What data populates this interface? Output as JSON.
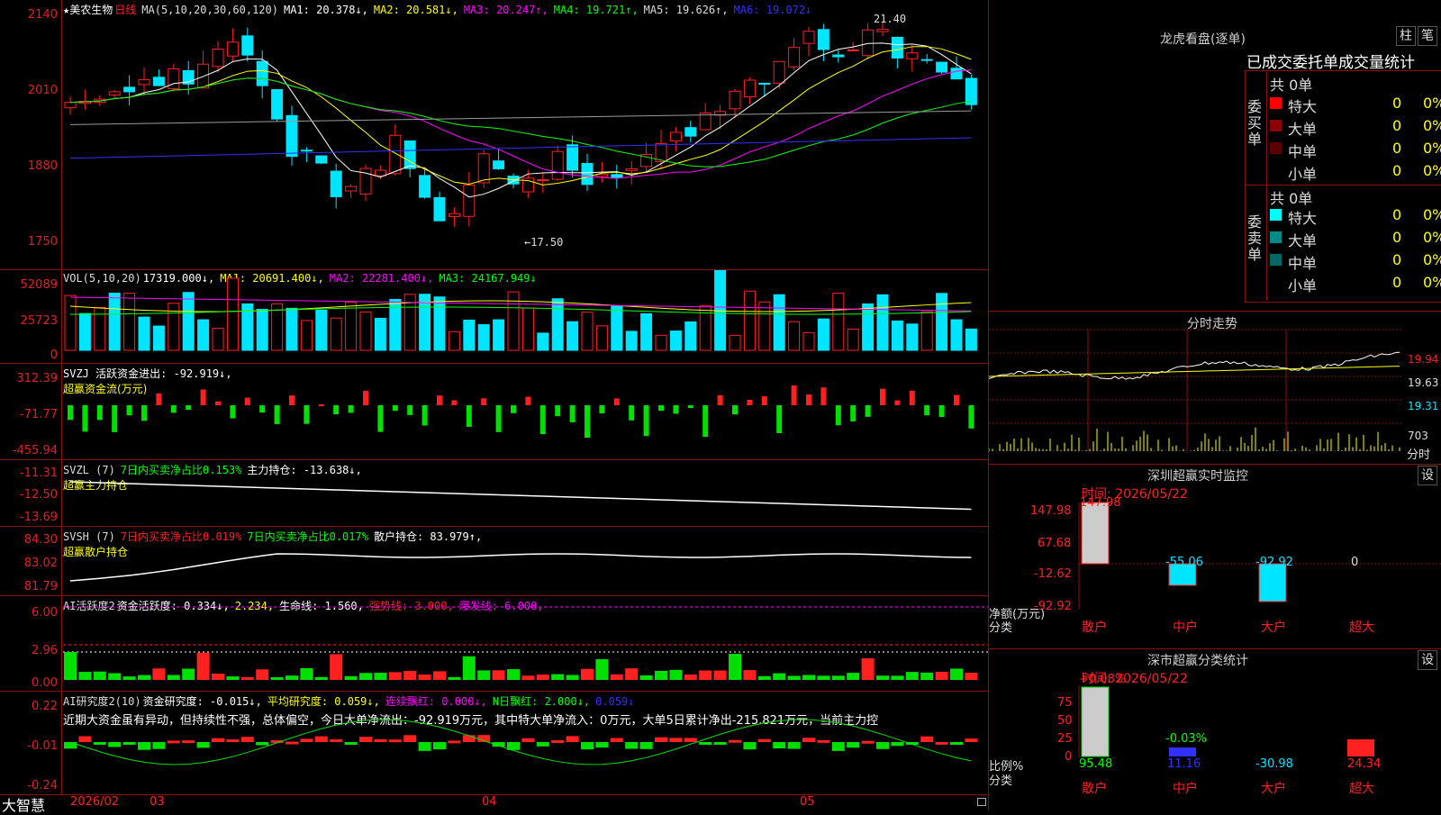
{
  "kline": {
    "star": "★",
    "stock_name": "美农生物",
    "period": "日线",
    "ma_spec": "MA(5,10,20,30,60,120)",
    "ma1": "MA1: 20.378↓,",
    "ma2": "MA2: 20.581↓,",
    "ma3": "MA3: 20.247↑,",
    "ma4": "MA4: 19.721↑,",
    "ma5": "MA5: 19.626↑,",
    "ma6": "MA6: 19.072↓",
    "y_labels": [
      "2140",
      "2010",
      "1880",
      "1750"
    ],
    "high_mark": "21.40",
    "low_mark": "←17.50"
  },
  "vol": {
    "spec": "VOL(5,10,20)",
    "v": "17319.000↓,",
    "ma1": "MA1: 20691.400↓,",
    "ma2": "MA2: 22281.400↓,",
    "ma3": "MA3: 24167.949↓",
    "y_labels": [
      "52089",
      "25723",
      "0"
    ]
  },
  "svzj": {
    "line1": "SVZJ  活跃资金进出: -92.919↓,",
    "line2": "超赢资金流(万元)",
    "y_labels": [
      "312.39",
      "-71.77",
      "-455.94"
    ]
  },
  "svzl": {
    "spec": "SVZL (7)",
    "a": "7日内买卖净占比0.153%",
    "b": "主力持仓: -13.638↓,",
    "line2": "超赢主力持仓",
    "y_labels": [
      "-11.31",
      "-12.50",
      "-13.69"
    ]
  },
  "svsh": {
    "spec": "SVSH (7)",
    "a": "7日内买卖净占比0.019%",
    "b": "7日内买卖净占比0.017%",
    "c": "散户持仓: 83.979↑,",
    "line2": "超赢散户持仓",
    "y_labels": [
      "84.30",
      "83.02",
      "81.79"
    ]
  },
  "ai1": {
    "spec": "AI活跃度2",
    "a": "资金活跃度: 0.334↓,",
    "b": "2.234,",
    "c": "生命线: 1.560,",
    "d": "强势线: 3.000,",
    "e": "爆发线: 6.000,",
    "y_labels": [
      "6.00",
      "2.96",
      "0.00"
    ]
  },
  "ai2": {
    "spec": "AI研究度2(10)",
    "a": "资金研究度: -0.015↓,",
    "b": "平均研究度: 0.059↓,",
    "c": "连续飘红: 0.000↓,",
    "d": "N日飘红: 2.000↓,",
    "e": "0.059↓",
    "desc": "近期大资金虽有异动，但持续性不强，总体偏空，今日大单净流出：-92.919万元，其中特大单净流入：0万元，大单5日累计净出-215.821万元，当前主力控",
    "y_labels": [
      "0.22",
      "-0.01",
      "-0.24"
    ]
  },
  "bottom": {
    "brand": "大智慧",
    "date_start": "2026/02",
    "m03": "03",
    "m04": "04",
    "m05": "05"
  },
  "right": {
    "lhkp_title": "龙虎看盘(逐单)",
    "btn_zhu": "柱",
    "btn_bi": "笔",
    "table_header": "已成交委托单成交量统计",
    "buy_side": "委买单",
    "sell_side": "委卖单",
    "buy_total": "共 0单",
    "sell_total": "共 0单",
    "buy_rows": [
      {
        "label": "特大",
        "v": "0",
        "p": "0%"
      },
      {
        "label": "大单",
        "v": "0",
        "p": "0%"
      },
      {
        "label": "中单",
        "v": "0",
        "p": "0%"
      },
      {
        "label": "小单",
        "v": "0",
        "p": "0%"
      }
    ],
    "sell_rows": [
      {
        "label": "特大",
        "v": "0",
        "p": "0%"
      },
      {
        "label": "大单",
        "v": "0",
        "p": "0%"
      },
      {
        "label": "中单",
        "v": "0",
        "p": "0%"
      },
      {
        "label": "小单",
        "v": "0",
        "p": "0%"
      }
    ],
    "intraday_title": "分时走势",
    "intraday_prices": [
      "19.94",
      "19.63",
      "19.31"
    ],
    "intraday_vol": "703",
    "intraday_vol_label": "分时",
    "sz_monitor_title": "深圳超赢实时监控",
    "set": "设",
    "time1": "时间: 2026/05/22",
    "mon_y": [
      "147.98",
      "67.68",
      "-12.62",
      "-92.92"
    ],
    "mon_values": {
      "sanhu": "147.98",
      "zhonghu": "-55.06",
      "dahu": "-92.92",
      "chaoda": "0"
    },
    "mon_unit": "净额(万元)",
    "mon_cat": "分类",
    "cats": [
      "散户",
      "中户",
      "大户",
      "超大"
    ],
    "sz_class_title": "深市超赢分类统计",
    "time2": "时间: 2026/05/22",
    "cls_y": [
      "75",
      "50",
      "25",
      "0"
    ],
    "cls_top": {
      "sanhu": "+0.08%",
      "zhonghu": "-0.03%"
    },
    "cls_bottom": [
      "95.48",
      "11.16",
      "-30.98",
      "24.34"
    ],
    "cls_ratio": "比例%",
    "cls_cat": "分类"
  },
  "colors": {
    "up": "#ff2020",
    "down": "#00e5ff",
    "ma1": "#ffffff",
    "ma2": "#ffff00",
    "ma3": "#ff00ff",
    "ma4": "#00ff00",
    "ma5": "#9a9a9a",
    "ma6": "#3030ff",
    "grid": "#8a1010"
  }
}
